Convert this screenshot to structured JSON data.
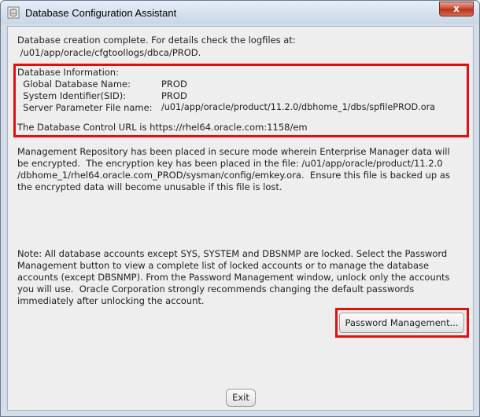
{
  "window": {
    "title": "Database Configuration Assistant",
    "close_label": "x"
  },
  "intro": {
    "line1": "Database creation complete. For details check the logfiles at:",
    "line2": " /u01/app/oracle/cfgtoollogs/dbca/PROD."
  },
  "db_info": {
    "heading": "Database Information:",
    "rows": [
      {
        "label": "  Global Database Name:",
        "value": "PROD"
      },
      {
        "label": "  System Identifier(SID):",
        "value": "PROD"
      },
      {
        "label": "  Server Parameter File name:",
        "value": "/u01/app/oracle/product/11.2.0/dbhome_1/dbs/spfilePROD.ora"
      }
    ],
    "control_url_line": "The Database Control URL is https://rhel64.oracle.com:1158/em"
  },
  "repository": {
    "lines": [
      "Management Repository has been placed in secure mode wherein Enterprise Manager data will",
      "be encrypted.  The encryption key has been placed in the file: /u01/app/oracle/product/11.2.0",
      "/dbhome_1/rhel64.oracle.com_PROD/sysman/config/emkey.ora.  Ensure this file is backed up as",
      "the encrypted data will become unusable if this file is lost."
    ]
  },
  "note": {
    "lines": [
      "Note: All database accounts except SYS, SYSTEM and DBSNMP are locked. Select the Password",
      "Management button to view a complete list of locked accounts or to manage the database",
      "accounts (except DBSNMP). From the Password Management window, unlock only the accounts",
      "you will use.  Oracle Corporation strongly recommends changing the default passwords",
      "immediately after unlocking the account."
    ]
  },
  "buttons": {
    "password_management": "Password Management...",
    "exit": "Exit"
  },
  "colors": {
    "highlight_box": "#e01010"
  }
}
